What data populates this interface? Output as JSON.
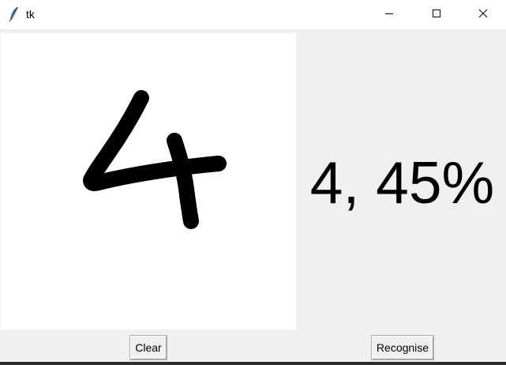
{
  "window": {
    "title": "tk",
    "icon": "feather-icon",
    "controls": {
      "minimize_icon": "minimize-icon",
      "maximize_icon": "maximize-icon",
      "close_icon": "close-icon"
    }
  },
  "canvas": {
    "background": "#ffffff",
    "stroke_color": "#000000",
    "drawing": "handwritten-digit"
  },
  "result": {
    "text": "4, 45%"
  },
  "buttons": {
    "clear_label": "Clear",
    "recognise_label": "Recognise"
  },
  "colors": {
    "window_bg": "#f0f0f0",
    "titlebar_bg": "#ffffff",
    "text": "#000000"
  }
}
